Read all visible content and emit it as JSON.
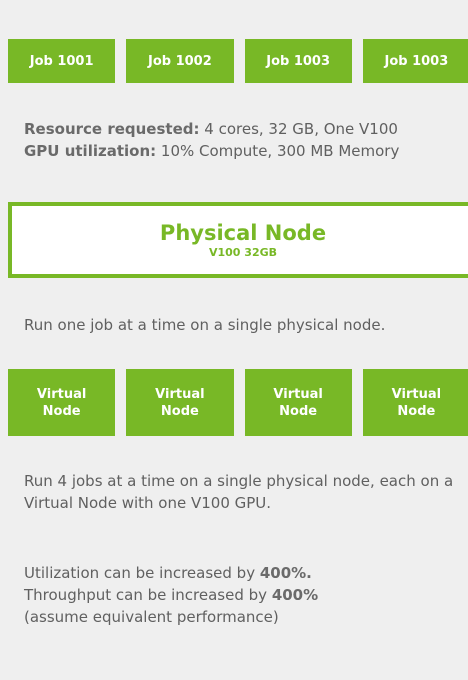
{
  "jobs": [
    "Job 1001",
    "Job 1002",
    "Job 1003",
    "Job 1003"
  ],
  "resource": {
    "requested_label": "Resource requested:",
    "requested_value": " 4 cores, 32 GB, One V100",
    "utilization_label": "GPU utilization:",
    "utilization_value": " 10% Compute, 300 MB Memory"
  },
  "physical_node": {
    "title": "Physical Node",
    "subtitle": "V100 32GB"
  },
  "single_job_text": "Run one job at a time on a single physical node.",
  "virtual_nodes": [
    {
      "line1": "Virtual",
      "line2": "Node"
    },
    {
      "line1": "Virtual",
      "line2": "Node"
    },
    {
      "line1": "Virtual",
      "line2": "Node"
    },
    {
      "line1": "Virtual",
      "line2": "Node"
    }
  ],
  "multi_job_text": "Run 4 jobs at a time on a single physical node, each on a Virtual Node with one V100 GPU.",
  "utilization_text": {
    "line1_prefix": "Utilization can be increased by ",
    "line1_value": "400%.",
    "line2_prefix": "Throughput can be increased by ",
    "line2_value": "400%",
    "line3": "(assume equivalent performance)"
  },
  "colors": {
    "accent": "#78b826",
    "background": "#efefef",
    "text": "#606060"
  }
}
